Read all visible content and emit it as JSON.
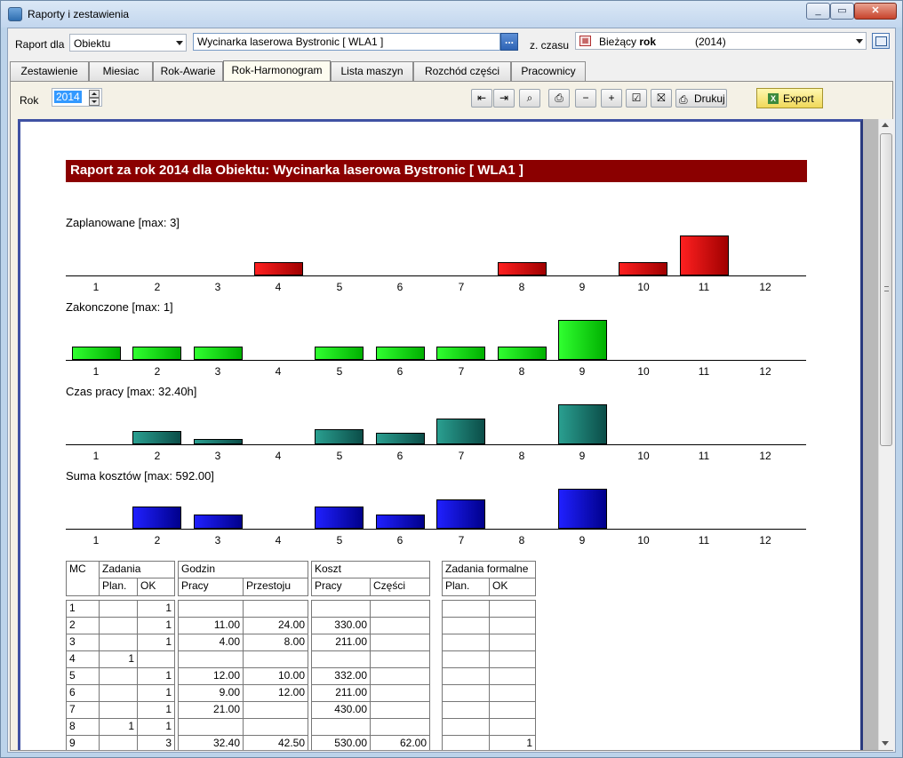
{
  "window": {
    "title": "Raporty i zestawienia"
  },
  "toprow": {
    "raport_label": "Raport dla",
    "raport_combo": "Obiektu",
    "object_value": "Wycinarka laserowa Bystronic [ WLA1 ]",
    "browse_label": "...",
    "zczasu_label": "z. czasu",
    "czas_prefix": "Bieżący ",
    "czas_bold": "rok",
    "czas_year": "(2014)"
  },
  "tabs": [
    "Zestawienie",
    "Miesiac",
    "Rok-Awarie",
    "Rok-Harmonogram",
    "Lista maszyn",
    "Rozchód części",
    "Pracownicy"
  ],
  "active_tab": "Rok-Harmonogram",
  "toolbar": {
    "rok_label": "Rok",
    "rok_value": "2014",
    "print_label": "Drukuj",
    "export_label": "Export"
  },
  "report": {
    "title": "Raport za rok 2014 dla Obiektu: Wycinarka laserowa Bystronic [ WLA1 ]",
    "months": [
      "1",
      "2",
      "3",
      "4",
      "5",
      "6",
      "7",
      "8",
      "9",
      "10",
      "11",
      "12"
    ]
  },
  "chart_data": [
    {
      "type": "bar",
      "title": "Zaplanowane  [max: 3]",
      "categories": [
        "1",
        "2",
        "3",
        "4",
        "5",
        "6",
        "7",
        "8",
        "9",
        "10",
        "11",
        "12"
      ],
      "values": [
        0,
        0,
        0,
        1,
        0,
        0,
        0,
        1,
        0,
        1,
        3,
        0
      ],
      "ylim": [
        0,
        3
      ],
      "color": "#e00000"
    },
    {
      "type": "bar",
      "title": "Zakonczone  [max: 1]",
      "categories": [
        "1",
        "2",
        "3",
        "4",
        "5",
        "6",
        "7",
        "8",
        "9",
        "10",
        "11",
        "12"
      ],
      "values": [
        1,
        1,
        1,
        0,
        1,
        1,
        1,
        1,
        3,
        0,
        0,
        0
      ],
      "ylim": [
        0,
        3
      ],
      "color": "#00e000"
    },
    {
      "type": "bar",
      "title": "Czas pracy  [max: 32.40h]",
      "categories": [
        "1",
        "2",
        "3",
        "4",
        "5",
        "6",
        "7",
        "8",
        "9",
        "10",
        "11",
        "12"
      ],
      "values": [
        0,
        11,
        4,
        0,
        12,
        9,
        21,
        0,
        32.4,
        0,
        0,
        0
      ],
      "ylim": [
        0,
        32.4
      ],
      "color": "#1a7a70"
    },
    {
      "type": "bar",
      "title": "Suma kosztów  [max:  592.00]",
      "categories": [
        "1",
        "2",
        "3",
        "4",
        "5",
        "6",
        "7",
        "8",
        "9",
        "10",
        "11",
        "12"
      ],
      "values": [
        0,
        330,
        211,
        0,
        332,
        211,
        430,
        0,
        592,
        0,
        0,
        0
      ],
      "ylim": [
        0,
        592
      ],
      "color": "#0000e0"
    }
  ],
  "table": {
    "h_mc": "MC",
    "h_zadania": "Zadania",
    "h_godzin": "Godzin",
    "h_koszt": "Koszt",
    "h_zf": "Zadania formalne",
    "h_plan": "Plan.",
    "h_ok": "OK",
    "h_pracy": "Pracy",
    "h_przestoju": "Przestoju",
    "h_pracy2": "Pracy",
    "h_czesci": "Części",
    "h_plan2": "Plan.",
    "h_ok2": "OK",
    "rows": [
      [
        "1",
        "",
        "1",
        "",
        "",
        "",
        ""
      ],
      [
        "2",
        "",
        "1",
        "11.00",
        "24.00",
        "330.00",
        ""
      ],
      [
        "3",
        "",
        "1",
        "4.00",
        "8.00",
        "211.00",
        ""
      ],
      [
        "4",
        "1",
        "",
        "",
        "",
        "",
        ""
      ],
      [
        "5",
        "",
        "1",
        "12.00",
        "10.00",
        "332.00",
        ""
      ],
      [
        "6",
        "",
        "1",
        "9.00",
        "12.00",
        "211.00",
        ""
      ],
      [
        "7",
        "",
        "1",
        "21.00",
        "",
        "430.00",
        ""
      ],
      [
        "8",
        "1",
        "1",
        "",
        "",
        "",
        ""
      ],
      [
        "9",
        "",
        "3",
        "32.40",
        "42.50",
        "530.00",
        "62.00"
      ]
    ],
    "row9_zf_ok": "1"
  }
}
